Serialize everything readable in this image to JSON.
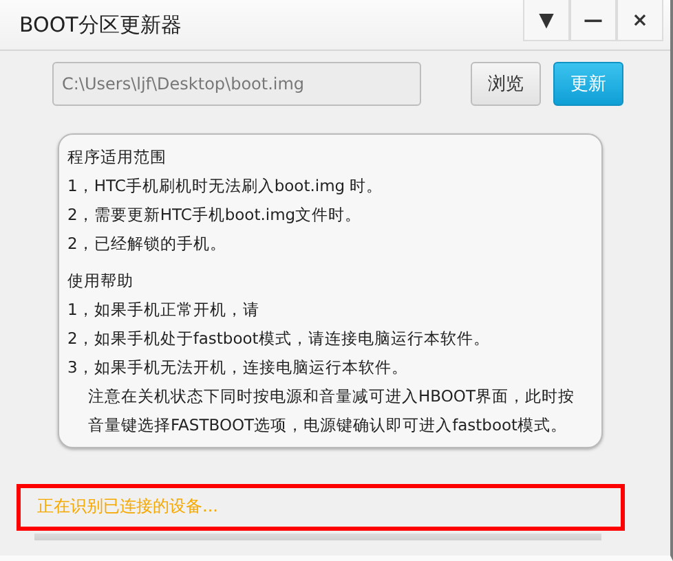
{
  "window": {
    "title": "BOOT分区更新器",
    "controls": [
      "▼",
      "—",
      "×"
    ]
  },
  "path_field": {
    "value": "C:\\Users\\ljf\\Desktop\\boot.img"
  },
  "buttons": [
    {
      "label": "浏览",
      "kind": "default"
    },
    {
      "label": "更新",
      "kind": "primary"
    }
  ],
  "info_panel": {
    "sections": [
      {
        "heading": "程序适用范围",
        "lines": [
          {
            "text": "1，HTC手机刷机时无法刷入boot.img 时。",
            "kind": "item"
          },
          {
            "text": "2，需要更新HTC手机boot.img文件时。",
            "kind": "item"
          },
          {
            "text": "2，已经解锁的手机。",
            "kind": "item"
          }
        ]
      },
      {
        "heading": "使用帮助",
        "lines": [
          {
            "text": "1，如果手机正常开机，请",
            "kind": "item"
          },
          {
            "text": "2，如果手机处于fastboot模式，请连接电脑运行本软件。",
            "kind": "item"
          },
          {
            "text": "3，如果手机无法开机，连接电脑运行本软件。",
            "kind": "item"
          },
          {
            "text": "注意在关机状态下同时按电源和音量减可进入HBOOT界面，此时按",
            "kind": "note"
          },
          {
            "text": "音量键选择FASTBOOT选项，电源键确认即可进入fastboot模式。",
            "kind": "note"
          }
        ]
      }
    ]
  },
  "status": {
    "text": "正在识别已连接的设备...",
    "highlighted": true
  }
}
